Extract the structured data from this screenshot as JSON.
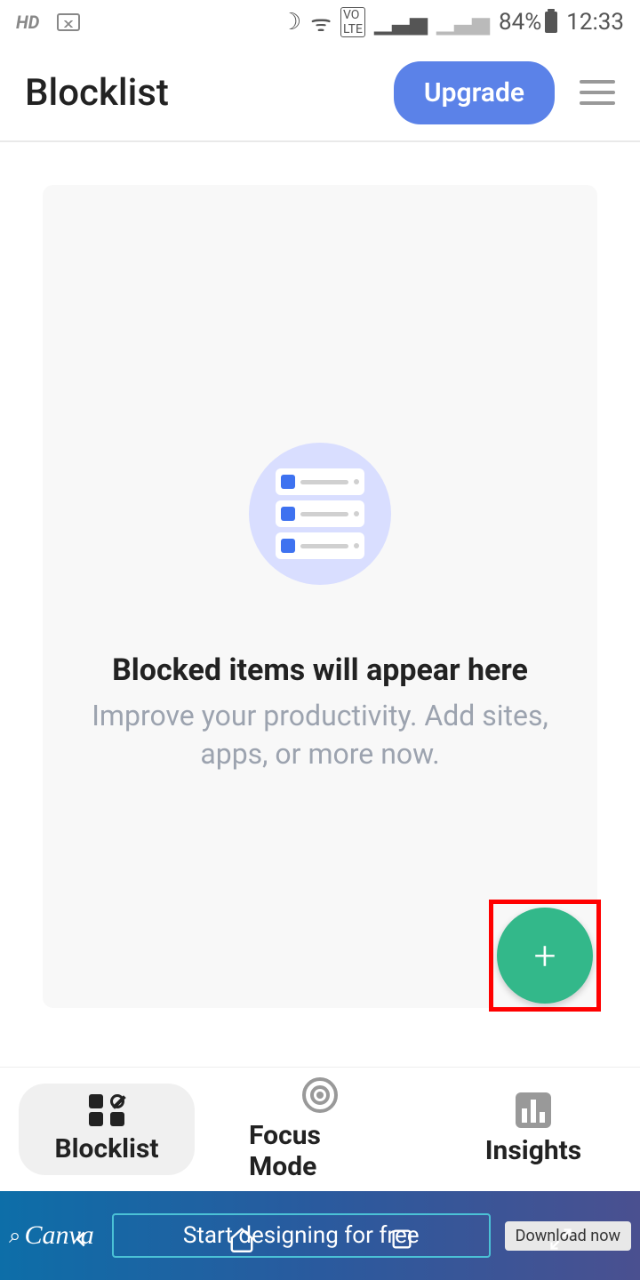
{
  "status": {
    "hd": "HD",
    "battery": "84%",
    "time": "12:33"
  },
  "header": {
    "title": "Blocklist",
    "upgrade": "Upgrade"
  },
  "empty": {
    "title": "Blocked items will appear here",
    "subtitle": "Improve your productivity. Add sites, apps, or more now."
  },
  "fab": {
    "label": "+"
  },
  "nav": {
    "blocklist": "Blocklist",
    "focus": "Focus Mode",
    "insights": "Insights"
  },
  "ad": {
    "brand": "Canva",
    "text": "Start designing for free",
    "cta": "Download now"
  }
}
